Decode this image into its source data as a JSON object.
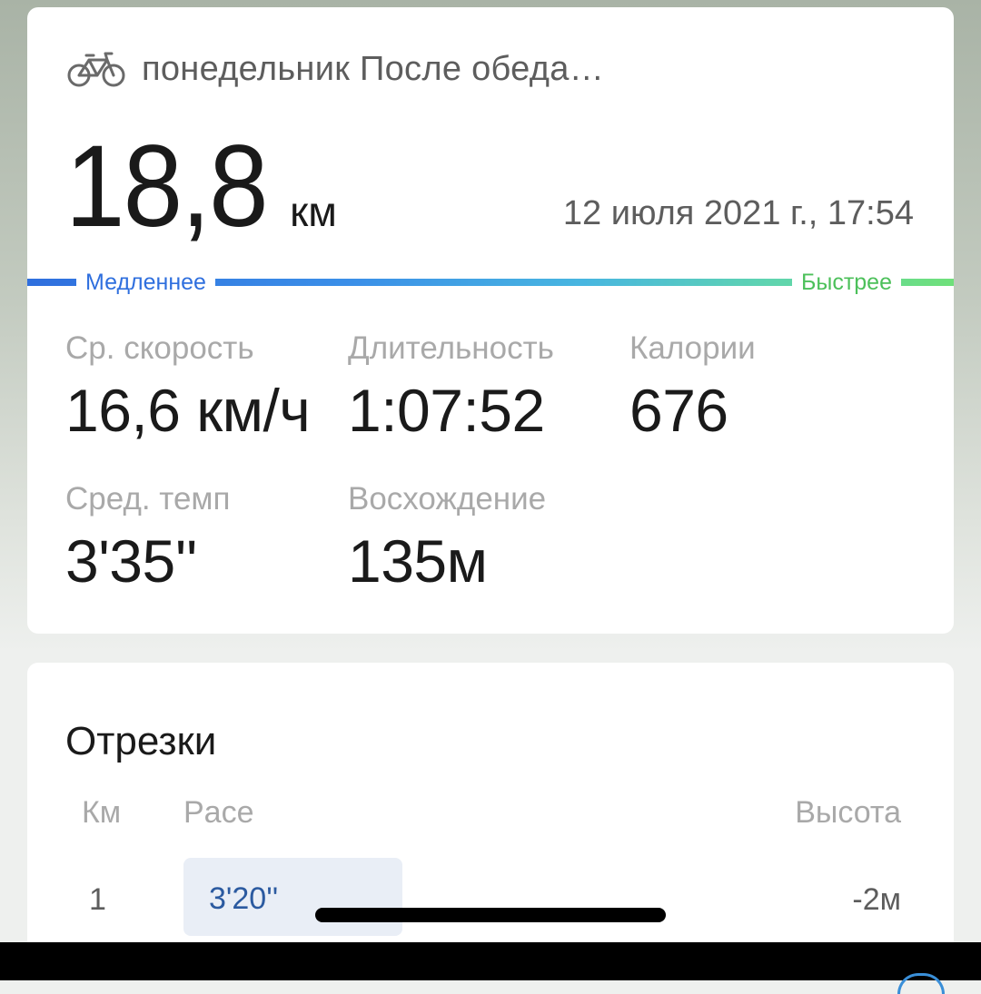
{
  "activity": {
    "icon": "bicycle-icon",
    "title": "понедельник После обеда…",
    "distance_value": "18,8",
    "distance_unit": "км",
    "datetime": "12 июля 2021 г., 17:54"
  },
  "speed_scale": {
    "slow_label": "Медленнее",
    "fast_label": "Быстрее",
    "colors": [
      "#2f6fde",
      "#48b6e0",
      "#6fe07a"
    ]
  },
  "stats": [
    {
      "label": "Ср. скорость",
      "value": "16,6 км/ч"
    },
    {
      "label": "Длительность",
      "value": "1:07:52"
    },
    {
      "label": "Калории",
      "value": "676"
    },
    {
      "label": "Сред. темп",
      "value": "3'35''"
    },
    {
      "label": "Восхождение",
      "value": "135м"
    }
  ],
  "splits": {
    "title": "Отрезки",
    "columns": {
      "km": "Км",
      "pace": "Pace",
      "altitude": "Высота"
    },
    "rows": [
      {
        "km": "1",
        "pace": "3'20''",
        "altitude": "-2м"
      }
    ]
  }
}
